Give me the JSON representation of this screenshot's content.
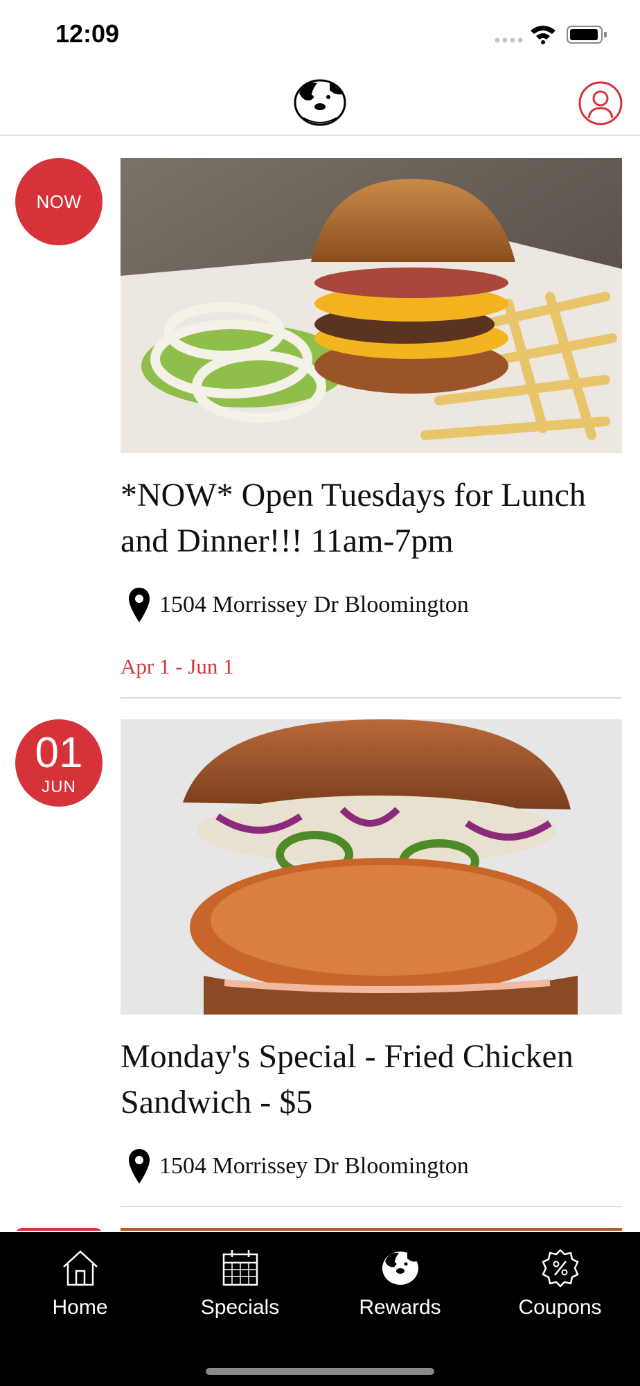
{
  "status_bar": {
    "time": "12:09"
  },
  "header": {
    "logo_name": "dog-logo",
    "profile_icon": "profile-icon"
  },
  "colors": {
    "accent": "#d6323a",
    "tab_bar": "#000000",
    "divider": "#dcdcdc"
  },
  "feed": [
    {
      "badge_text": "NOW",
      "title_line1": "*NOW* Open Tuesdays for Lunch",
      "title_line2": "and Dinner!!! 11am-7pm",
      "location": "1504 Morrissey Dr Bloomington",
      "date_range": "Apr 1 - Jun 1"
    },
    {
      "badge_day": "01",
      "badge_month": "JUN",
      "title_line1": "Monday's Special - Fried Chicken",
      "title_line2": "Sandwich - $5",
      "location": "1504 Morrissey Dr Bloomington"
    }
  ],
  "tabs": [
    {
      "label": "Home",
      "icon": "home-icon"
    },
    {
      "label": "Specials",
      "icon": "calendar-icon"
    },
    {
      "label": "Rewards",
      "icon": "dog-logo-icon"
    },
    {
      "label": "Coupons",
      "icon": "coupon-icon"
    }
  ]
}
